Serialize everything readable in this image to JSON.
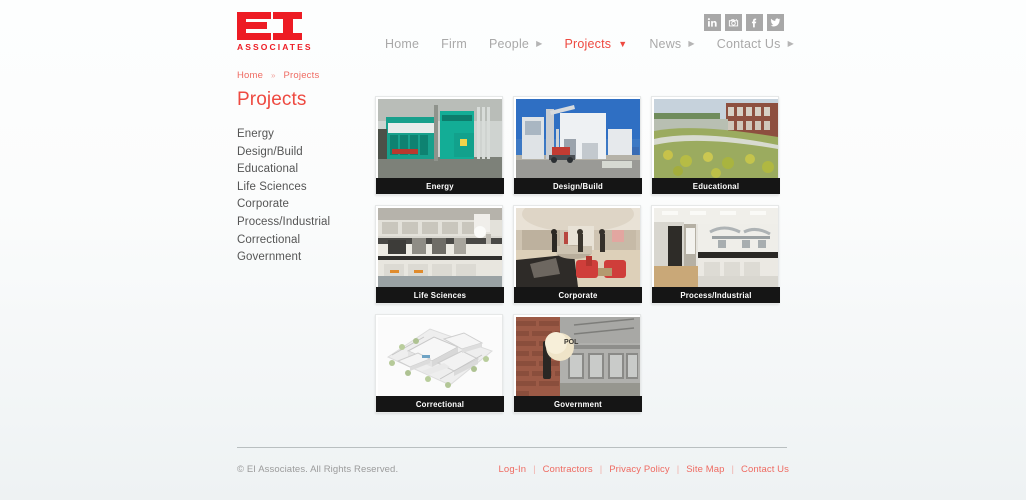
{
  "brand": {
    "logo_mark": "EI",
    "logo_word": "ASSOCIATES",
    "accent_red": "#ED1C24",
    "link_red": "#ee4a41"
  },
  "nav": {
    "items": [
      {
        "label": "Home",
        "arrow": "",
        "active": false
      },
      {
        "label": "Firm",
        "arrow": "",
        "active": false
      },
      {
        "label": "People",
        "arrow": "▶",
        "active": false
      },
      {
        "label": "Projects",
        "arrow": "▼",
        "active": true
      },
      {
        "label": "News",
        "arrow": "▶",
        "active": false
      },
      {
        "label": "Contact Us",
        "arrow": "▶",
        "active": false
      }
    ]
  },
  "social": {
    "items": [
      {
        "name": "linkedin-icon",
        "label": "in"
      },
      {
        "name": "instagram-icon",
        "label": "Instagram"
      },
      {
        "name": "facebook-icon",
        "label": "f"
      },
      {
        "name": "twitter-icon",
        "label": "Twitter"
      }
    ]
  },
  "breadcrumb": {
    "home": "Home",
    "separator": "»",
    "current": "Projects"
  },
  "page": {
    "title": "Projects"
  },
  "sub_nav": {
    "items": [
      {
        "label": "Energy"
      },
      {
        "label": "Design/Build"
      },
      {
        "label": "Educational"
      },
      {
        "label": "Life Sciences"
      },
      {
        "label": "Corporate"
      },
      {
        "label": "Process/Industrial"
      },
      {
        "label": "Correctional"
      },
      {
        "label": "Government"
      }
    ]
  },
  "projects": {
    "cards": [
      {
        "caption": "Energy",
        "image": "teal-generator-plant"
      },
      {
        "caption": "Design/Build",
        "image": "construction-crane-white-building"
      },
      {
        "caption": "Educational",
        "image": "green-roof-brick-school"
      },
      {
        "caption": "Life Sciences",
        "image": "laboratory-benches"
      },
      {
        "caption": "Corporate",
        "image": "office-lobby-red-chairs"
      },
      {
        "caption": "Process/Industrial",
        "image": "cleanroom-stainless-tanks"
      },
      {
        "caption": "Correctional",
        "image": "site-plan-3d-rendering"
      },
      {
        "caption": "Government",
        "image": "police-station-globe-lamp"
      }
    ]
  },
  "footer": {
    "copyright": "© EI Associates. All Rights Reserved.",
    "separator": "|",
    "links": [
      {
        "label": "Log-In"
      },
      {
        "label": "Contractors"
      },
      {
        "label": "Privacy Policy"
      },
      {
        "label": "Site Map"
      },
      {
        "label": "Contact Us"
      }
    ]
  }
}
